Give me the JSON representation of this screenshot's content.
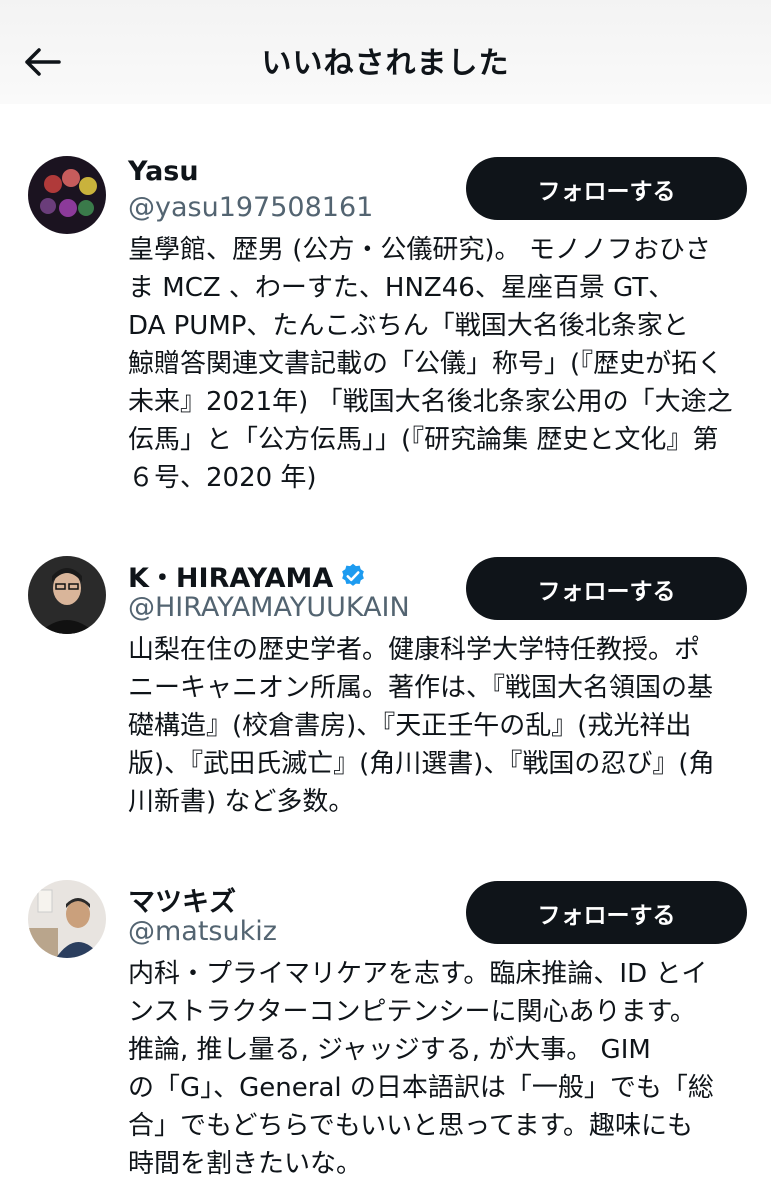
{
  "header": {
    "title": "いいねされました"
  },
  "users": [
    {
      "name": "Yasu",
      "handle": "@yasu197508161",
      "verified": false,
      "follow_label": "フォローする",
      "bio": "皇學館、歴男 (公方・公儀研究)。 モノノフおひさ\nま MCZ 、わーすた、HNZ46、星座百景 GT、\nDA PUMP、たんこぶちん「戦国大名後北条家と\n鯨贈答関連文書記載の「公儀」称号」(『歴史が拓く\n未来』2021年) 「戦国大名後北条家公用の「大途之\n伝馬」と「公方伝馬」」(『研究論集 歴史と文化』第\n６号、2020 年)"
    },
    {
      "name": "K・HIRAYAMA",
      "handle": "@HIRAYAMAYUUKAIN",
      "verified": true,
      "follow_label": "フォローする",
      "bio": "山梨在住の歴史学者。健康科学大学特任教授。ポ\nニーキャニオン所属。著作は、『戦国大名領国の基\n礎構造』(校倉書房)、『天正壬午の乱』(戎光祥出\n版)、『武田氏滅亡』(角川選書)、『戦国の忍び』(角\n川新書) など多数。"
    },
    {
      "name": "マツキズ",
      "handle": "@matsukiz",
      "verified": false,
      "follow_label": "フォローする",
      "bio": "内科・プライマリケアを志す。臨床推論、ID とイ\nンストラクターコンピテンシーに関心あります。\n推論, 推し量る, ジャッジする, が大事。 GIM\nの「G」、General の日本語訳は「一般」でも「総\n合」でもどちらでもいいと思ってます。趣味にも\n時間を割きたいな。"
    }
  ]
}
